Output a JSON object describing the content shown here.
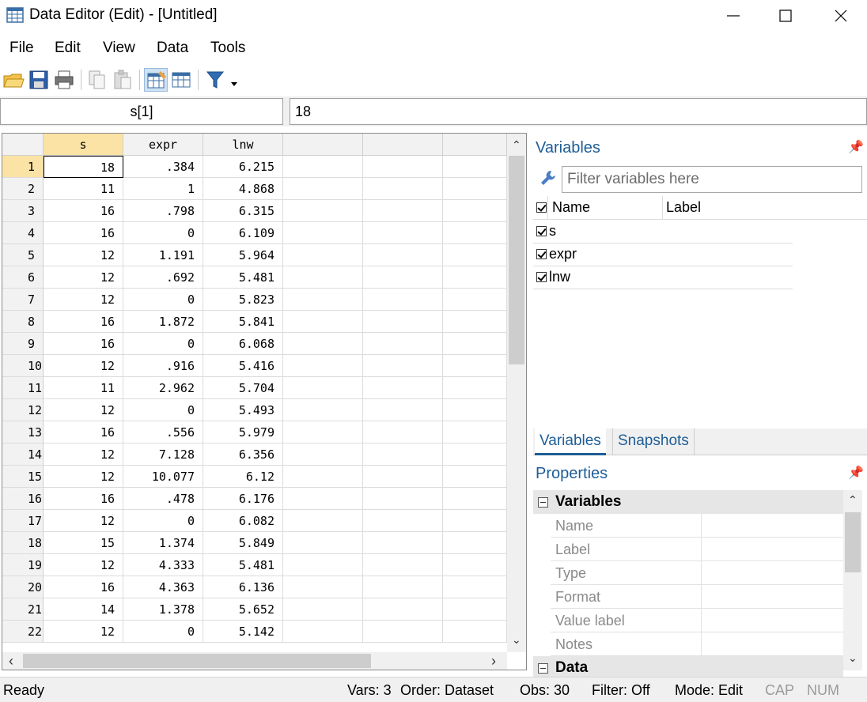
{
  "window": {
    "title": "Data Editor (Edit) - [Untitled]"
  },
  "menu": [
    "File",
    "Edit",
    "View",
    "Data",
    "Tools"
  ],
  "toolbar": {
    "icons": [
      "open-folder-icon",
      "save-icon",
      "print-icon",
      "copy-icon",
      "paste-icon",
      "data-editor-edit-icon",
      "data-editor-browse-icon",
      "filter-icon"
    ]
  },
  "cellbar": {
    "cell_name": "s[1]",
    "cell_value": "18"
  },
  "grid": {
    "columns": [
      "s",
      "expr",
      "lnw"
    ],
    "rows": [
      [
        "1",
        "18",
        ".384",
        "6.215"
      ],
      [
        "2",
        "11",
        "1",
        "4.868"
      ],
      [
        "3",
        "16",
        ".798",
        "6.315"
      ],
      [
        "4",
        "16",
        "0",
        "6.109"
      ],
      [
        "5",
        "12",
        "1.191",
        "5.964"
      ],
      [
        "6",
        "12",
        ".692",
        "5.481"
      ],
      [
        "7",
        "12",
        "0",
        "5.823"
      ],
      [
        "8",
        "16",
        "1.872",
        "5.841"
      ],
      [
        "9",
        "16",
        "0",
        "6.068"
      ],
      [
        "10",
        "12",
        ".916",
        "5.416"
      ],
      [
        "11",
        "11",
        "2.962",
        "5.704"
      ],
      [
        "12",
        "12",
        "0",
        "5.493"
      ],
      [
        "13",
        "16",
        ".556",
        "5.979"
      ],
      [
        "14",
        "12",
        "7.128",
        "6.356"
      ],
      [
        "15",
        "12",
        "10.077",
        "6.12"
      ],
      [
        "16",
        "16",
        ".478",
        "6.176"
      ],
      [
        "17",
        "12",
        "0",
        "6.082"
      ],
      [
        "18",
        "15",
        "1.374",
        "5.849"
      ],
      [
        "19",
        "12",
        "4.333",
        "5.481"
      ],
      [
        "20",
        "16",
        "4.363",
        "6.136"
      ],
      [
        "21",
        "14",
        "1.378",
        "5.652"
      ],
      [
        "22",
        "12",
        "0",
        "5.142"
      ]
    ]
  },
  "variables_panel": {
    "title": "Variables",
    "filter_placeholder": "Filter variables here",
    "header_name": "Name",
    "header_label": "Label",
    "items": [
      "s",
      "expr",
      "lnw"
    ]
  },
  "tabs": [
    "Variables",
    "Snapshots"
  ],
  "properties_panel": {
    "title": "Properties",
    "group_variables": "Variables",
    "fields": [
      "Name",
      "Label",
      "Type",
      "Format",
      "Value label",
      "Notes"
    ],
    "group_data": "Data"
  },
  "statusbar": {
    "ready": "Ready",
    "vars": "Vars: 3",
    "order": "Order: Dataset",
    "obs": "Obs: 30",
    "filter": "Filter: Off",
    "mode": "Mode: Edit",
    "cap": "CAP",
    "num": "NUM"
  }
}
